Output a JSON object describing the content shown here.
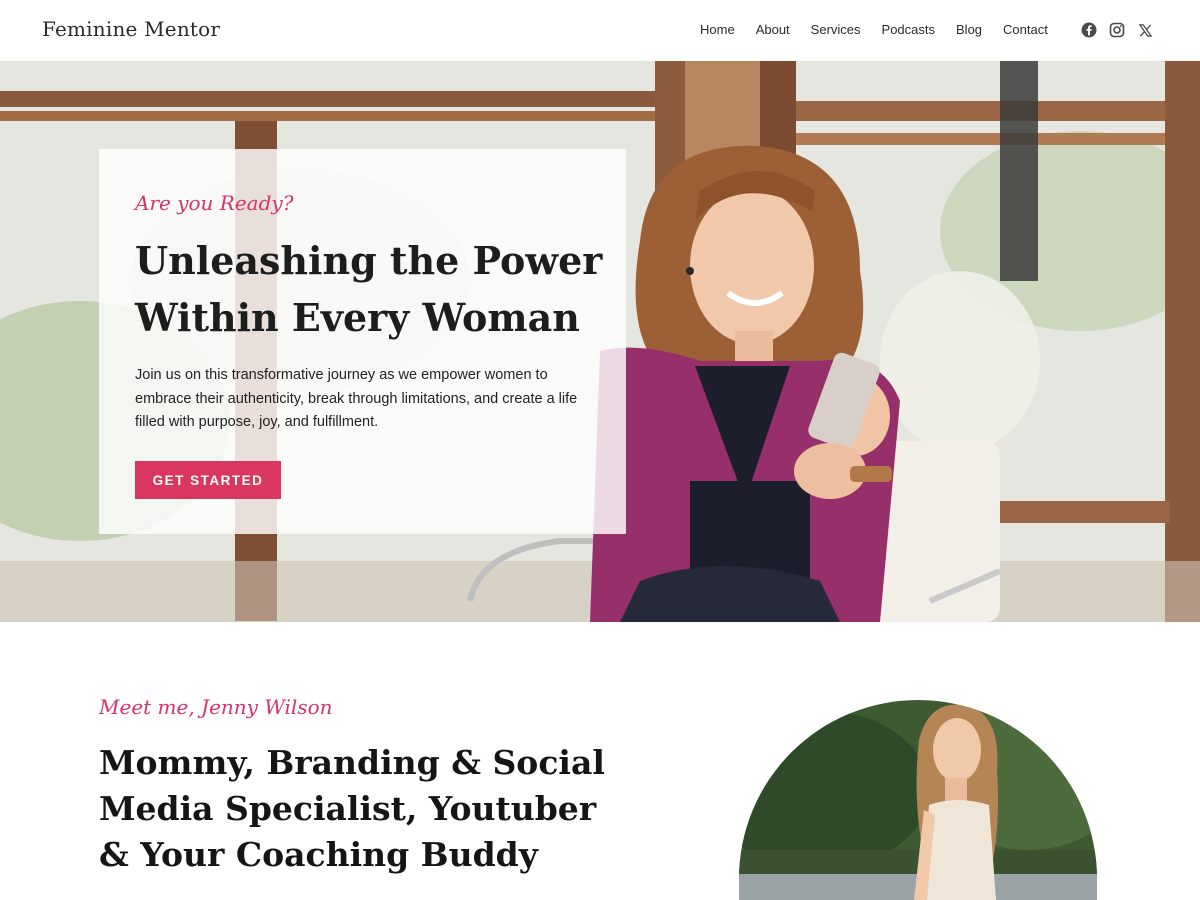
{
  "header": {
    "logo": "Feminine Mentor",
    "nav": [
      "Home",
      "About",
      "Services",
      "Podcasts",
      "Blog",
      "Contact"
    ],
    "social_icons": [
      "facebook-icon",
      "instagram-icon",
      "x-icon"
    ]
  },
  "hero": {
    "kicker": "Are you Ready?",
    "title": "Unleashing the Power Within Every Woman",
    "text": "Join us on this transformative journey as we empower women to embrace their authenticity, break through limitations, and create a life filled with purpose, joy, and fulfillment.",
    "button": "GET STARTED"
  },
  "about": {
    "kicker": "Meet me, Jenny Wilson",
    "title": "Mommy, Branding & Social Media Specialist, Youtuber & Your Coaching Buddy"
  },
  "colors": {
    "accent": "#d9375f",
    "kicker": "#d6336c"
  }
}
